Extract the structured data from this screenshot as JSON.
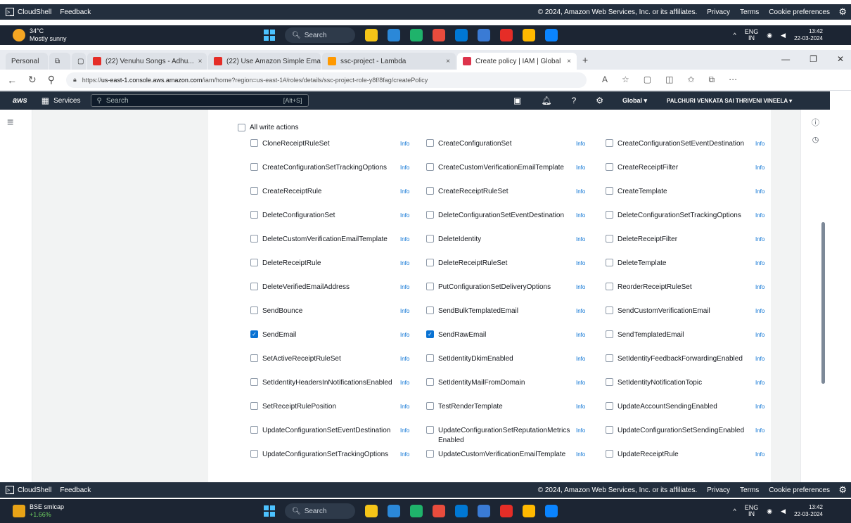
{
  "cloudshell_top": {
    "cloudshell": "CloudShell",
    "feedback": "Feedback",
    "copyright": "© 2024, Amazon Web Services, Inc. or its affiliates.",
    "privacy": "Privacy",
    "terms": "Terms",
    "cookies": "Cookie preferences"
  },
  "taskbar_top": {
    "weather_temp": "34°C",
    "weather_desc": "Mostly sunny",
    "search": "Search",
    "lang": "ENG",
    "lang2": "IN",
    "time": "13:42",
    "date": "22-03-2024"
  },
  "browser": {
    "tabs": [
      {
        "label": "Personal",
        "color": "#6b7684"
      },
      {
        "label": "(22) Venuhu Songs - Adhu...",
        "color": "#e52d27"
      },
      {
        "label": "(22) Use Amazon Simple Email S...",
        "color": "#e52d27"
      },
      {
        "label": "ssc-project - Lambda",
        "color": "#ff9900"
      },
      {
        "label": "Create policy | IAM | Global",
        "color": "#dd344c"
      }
    ],
    "url_prefix": "https://",
    "url_domain": "us-east-1.console.aws.amazon.com",
    "url_path": "/iam/home?region=us-east-1#/roles/details/ssc-project-role-y8f/8fag/createPolicy"
  },
  "aws_nav": {
    "logo": "aws",
    "services": "Services",
    "search": "Search",
    "shortcut": "[Alt+S]",
    "region": "Global ▾",
    "user": "PALCHURI VENKATA SAI THRIVENI VINEELA ▾"
  },
  "content": {
    "all_write": "All write actions",
    "info": "Info",
    "actions": [
      {
        "name": "CloneReceiptRuleSet",
        "checked": false
      },
      {
        "name": "CreateConfigurationSet",
        "checked": false
      },
      {
        "name": "CreateConfigurationSetEventDestination",
        "checked": false
      },
      {
        "name": "CreateConfigurationSetTrackingOptions",
        "checked": false
      },
      {
        "name": "CreateCustomVerificationEmailTemplate",
        "checked": false
      },
      {
        "name": "CreateReceiptFilter",
        "checked": false
      },
      {
        "name": "CreateReceiptRule",
        "checked": false
      },
      {
        "name": "CreateReceiptRuleSet",
        "checked": false
      },
      {
        "name": "CreateTemplate",
        "checked": false
      },
      {
        "name": "DeleteConfigurationSet",
        "checked": false
      },
      {
        "name": "DeleteConfigurationSetEventDestination",
        "checked": false
      },
      {
        "name": "DeleteConfigurationSetTrackingOptions",
        "checked": false
      },
      {
        "name": "DeleteCustomVerificationEmailTemplate",
        "checked": false
      },
      {
        "name": "DeleteIdentity",
        "checked": false
      },
      {
        "name": "DeleteReceiptFilter",
        "checked": false
      },
      {
        "name": "DeleteReceiptRule",
        "checked": false
      },
      {
        "name": "DeleteReceiptRuleSet",
        "checked": false
      },
      {
        "name": "DeleteTemplate",
        "checked": false
      },
      {
        "name": "DeleteVerifiedEmailAddress",
        "checked": false
      },
      {
        "name": "PutConfigurationSetDeliveryOptions",
        "checked": false
      },
      {
        "name": "ReorderReceiptRuleSet",
        "checked": false
      },
      {
        "name": "SendBounce",
        "checked": false
      },
      {
        "name": "SendBulkTemplatedEmail",
        "checked": false
      },
      {
        "name": "SendCustomVerificationEmail",
        "checked": false
      },
      {
        "name": "SendEmail",
        "checked": true
      },
      {
        "name": "SendRawEmail",
        "checked": true
      },
      {
        "name": "SendTemplatedEmail",
        "checked": false
      },
      {
        "name": "SetActiveReceiptRuleSet",
        "checked": false
      },
      {
        "name": "SetIdentityDkimEnabled",
        "checked": false
      },
      {
        "name": "SetIdentityFeedbackForwardingEnabled",
        "checked": false
      },
      {
        "name": "SetIdentityHeadersInNotificationsEnabled",
        "checked": false
      },
      {
        "name": "SetIdentityMailFromDomain",
        "checked": false
      },
      {
        "name": "SetIdentityNotificationTopic",
        "checked": false
      },
      {
        "name": "SetReceiptRulePosition",
        "checked": false
      },
      {
        "name": "TestRenderTemplate",
        "checked": false
      },
      {
        "name": "UpdateAccountSendingEnabled",
        "checked": false
      },
      {
        "name": "UpdateConfigurationSetEventDestination",
        "checked": false
      },
      {
        "name": "UpdateConfigurationSetReputationMetricsEnabled",
        "checked": false
      },
      {
        "name": "UpdateConfigurationSetSendingEnabled",
        "checked": false
      },
      {
        "name": "UpdateConfigurationSetTrackingOptions",
        "checked": false
      },
      {
        "name": "UpdateCustomVerificationEmailTemplate",
        "checked": false
      },
      {
        "name": "UpdateReceiptRule",
        "checked": false
      }
    ]
  },
  "taskbar_bottom": {
    "stock": "BSE smlcap",
    "stock_change": "+1.66%",
    "search": "Search",
    "lang": "ENG",
    "lang2": "IN",
    "time": "13:42",
    "date": "22-03-2024"
  }
}
